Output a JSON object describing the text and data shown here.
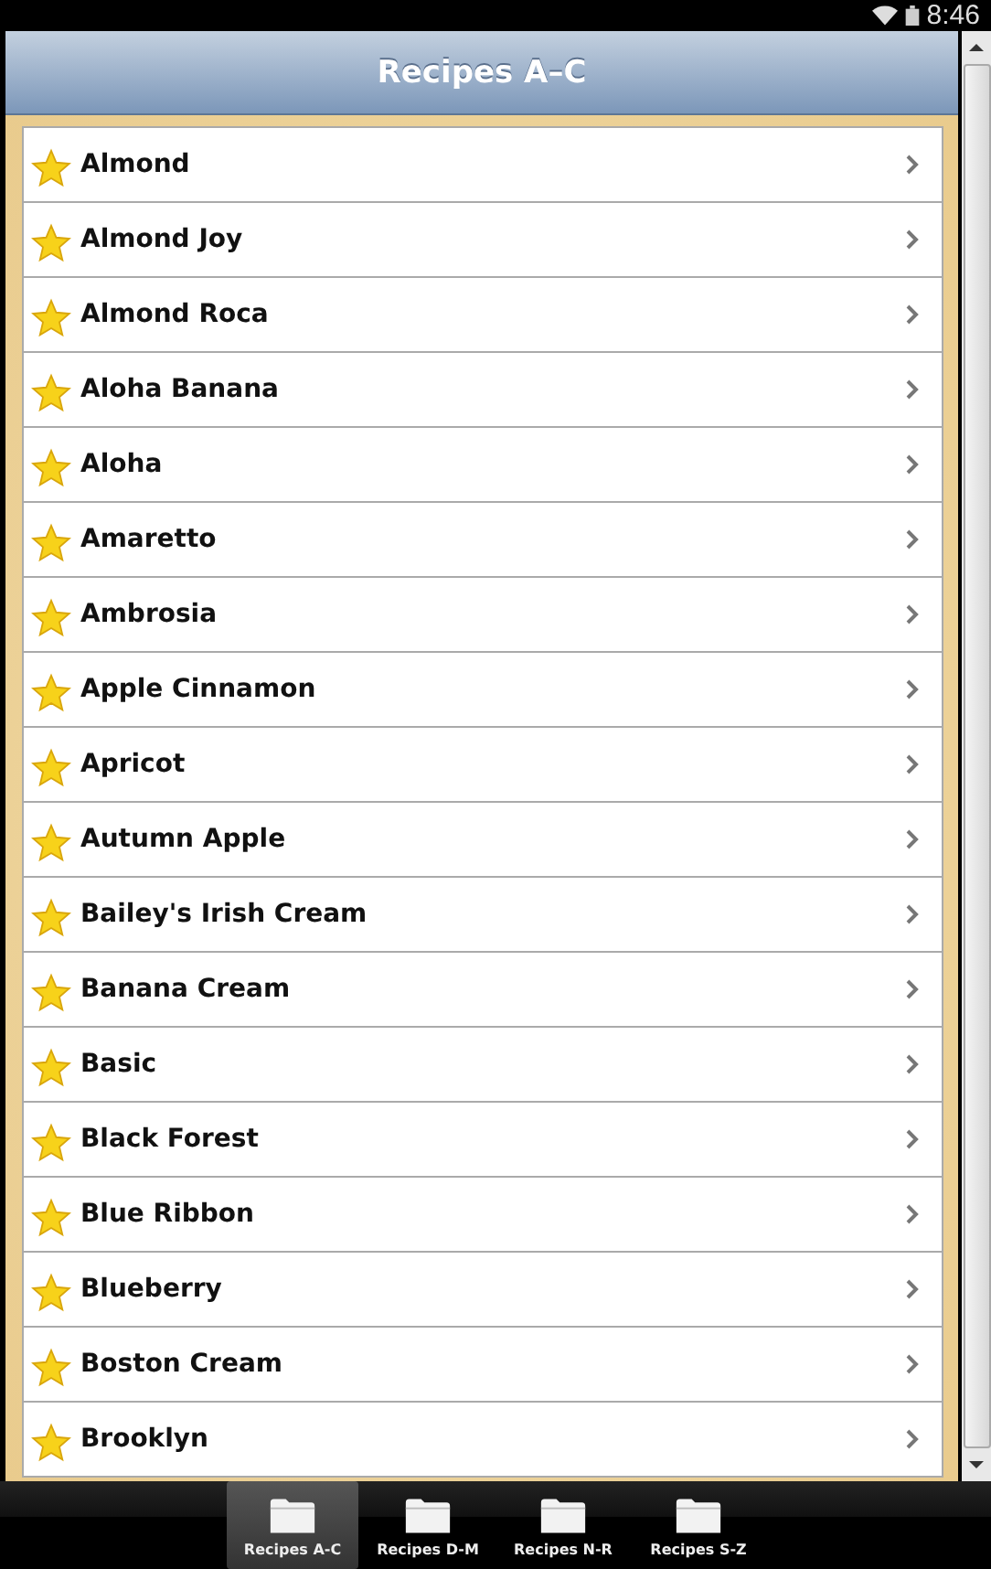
{
  "status_bar": {
    "time": "8:46"
  },
  "header": {
    "title": "Recipes A–C"
  },
  "recipes": [
    {
      "name": "Almond"
    },
    {
      "name": "Almond Joy"
    },
    {
      "name": "Almond Roca"
    },
    {
      "name": "Aloha Banana"
    },
    {
      "name": "Aloha"
    },
    {
      "name": "Amaretto"
    },
    {
      "name": "Ambrosia"
    },
    {
      "name": "Apple Cinnamon"
    },
    {
      "name": "Apricot"
    },
    {
      "name": "Autumn Apple"
    },
    {
      "name": "Bailey's Irish Cream"
    },
    {
      "name": "Banana Cream"
    },
    {
      "name": "Basic"
    },
    {
      "name": "Black Forest"
    },
    {
      "name": "Blue Ribbon"
    },
    {
      "name": "Blueberry"
    },
    {
      "name": "Boston Cream"
    },
    {
      "name": "Brooklyn"
    }
  ],
  "tabs": [
    {
      "label": "Recipes A-C",
      "selected": true
    },
    {
      "label": "Recipes D-M",
      "selected": false
    },
    {
      "label": "Recipes N-R",
      "selected": false
    },
    {
      "label": "Recipes S-Z",
      "selected": false
    }
  ]
}
